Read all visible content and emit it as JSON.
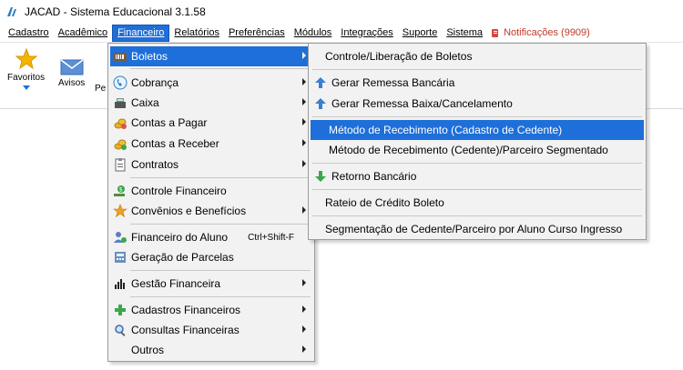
{
  "window": {
    "title": "JACAD - Sistema Educacional 3.1.58"
  },
  "menubar": {
    "items": [
      {
        "label": "Cadastro"
      },
      {
        "label": "Acadêmico"
      },
      {
        "label": "Financeiro"
      },
      {
        "label": "Relatórios"
      },
      {
        "label": "Preferências"
      },
      {
        "label": "Módulos"
      },
      {
        "label": "Integrações"
      },
      {
        "label": "Suporte"
      },
      {
        "label": "Sistema"
      }
    ],
    "notifications": "Notificações (9909)",
    "active_item": "Financeiro"
  },
  "toolbar": {
    "favoritos": "Favoritos",
    "avisos": "Avisos",
    "partial": "Pe"
  },
  "financeiro_menu": {
    "items": [
      {
        "label": "Boletos",
        "icon": "boletos-icon"
      },
      {
        "label": "Cobrança",
        "icon": "phone-icon"
      },
      {
        "label": "Caixa",
        "icon": "cash-register-icon"
      },
      {
        "label": "Contas a Pagar",
        "icon": "coins-icon"
      },
      {
        "label": "Contas a Receber",
        "icon": "coins-icon"
      },
      {
        "label": "Contratos",
        "icon": "clipboard-icon"
      },
      {
        "label": "Controle Financeiro",
        "icon": "money-hand-icon"
      },
      {
        "label": "Convênios e Benefícios",
        "icon": "star-icon"
      },
      {
        "label": "Financeiro do Aluno",
        "icon": "student-icon",
        "shortcut": "Ctrl+Shift-F"
      },
      {
        "label": "Geração de Parcelas",
        "icon": "calculator-icon"
      },
      {
        "label": "Gestão Financeira",
        "icon": "bar-chart-icon"
      },
      {
        "label": "Cadastros Financeiros",
        "icon": "plus-icon"
      },
      {
        "label": "Consultas Financeiras",
        "icon": "magnifier-icon"
      },
      {
        "label": "Outros",
        "icon": ""
      }
    ]
  },
  "boletos_submenu": {
    "items": [
      {
        "label": "Controle/Liberação de Boletos"
      },
      {
        "label": "Gerar Remessa Bancária",
        "icon": "upload-arrow-icon"
      },
      {
        "label": "Gerar Remessa Baixa/Cancelamento",
        "icon": "upload-arrow-icon"
      },
      {
        "label": "Método de Recebimento (Cadastro de Cedente)"
      },
      {
        "label": "Método de Recebimento (Cedente)/Parceiro Segmentado"
      },
      {
        "label": "Retorno Bancário",
        "icon": "download-arrow-icon"
      },
      {
        "label": "Rateio de Crédito Boleto"
      },
      {
        "label": "Segmentação de Cedente/Parceiro por Aluno Curso Ingresso"
      }
    ]
  },
  "colors": {
    "selection": "#1e6fd9",
    "notifications": "#c0392b",
    "menu_bg": "#f2f2f2"
  }
}
